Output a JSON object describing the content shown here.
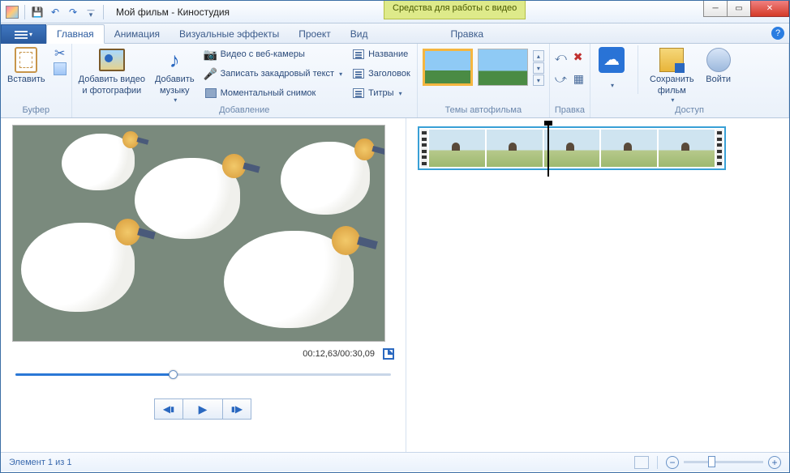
{
  "title": "Мой фильм - Киностудия",
  "context_tab": "Средства для работы с видео",
  "tabs": {
    "home": "Главная",
    "anim": "Анимация",
    "vfx": "Визуальные эффекты",
    "project": "Проект",
    "view": "Вид",
    "edit": "Правка"
  },
  "ribbon": {
    "buffer": {
      "label": "Буфер",
      "paste": "Вставить"
    },
    "add": {
      "label": "Добавление",
      "addmedia_l1": "Добавить видео",
      "addmedia_l2": "и фотографии",
      "addmusic_l1": "Добавить",
      "addmusic_l2": "музыку",
      "webcam": "Видео с веб-камеры",
      "narration": "Записать закадровый текст",
      "snapshot": "Моментальный снимок",
      "title": "Название",
      "caption": "Заголовок",
      "credits": "Титры"
    },
    "themes": {
      "label": "Темы автофильма"
    },
    "edit": {
      "label": "Правка"
    },
    "access": {
      "label": "Доступ",
      "save_l1": "Сохранить",
      "save_l2": "фильм",
      "signin": "Войти"
    }
  },
  "preview": {
    "time": "00:12,63/00:30,09",
    "progress_pct": 42
  },
  "status": {
    "left": "Элемент 1 из 1",
    "zoom_pct": 35
  }
}
